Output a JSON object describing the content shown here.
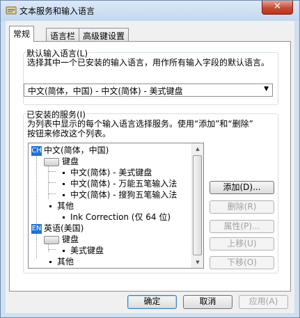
{
  "window": {
    "title": "文本服务和输入语言",
    "close_glyph": "✕"
  },
  "tabs": [
    {
      "label": "常规"
    },
    {
      "label": "语言栏"
    },
    {
      "label": "高级键设置"
    }
  ],
  "default_language": {
    "group_title": "默认输入语言(L)",
    "description": "选择其中一个已安装的输入语言，用作所有输入字段的默认语言。",
    "selected": "中文(简体，中国) - 中文(简体) - 美式键盘"
  },
  "installed_services": {
    "group_title": "已安装的服务(I)",
    "description_line1": "为列表中显示的每个输入语言选择服务。使用“添加”和“删除”",
    "description_line2": "按钮来修改这个列表。",
    "tree": {
      "lang_zh_badge": "CH",
      "lang_zh": "中文(简体，中国)",
      "keyboard_zh": "键盘",
      "kb_items_zh": [
        "中文(简体) - 美式键盘",
        "中文(简体) - 万能五笔输入法",
        "中文(简体) - 搜狗五笔输入法"
      ],
      "other_zh": "其他",
      "ink": "Ink Correction (仅 64 位)",
      "lang_en_badge": "EN",
      "lang_en": "英语(美国)",
      "keyboard_en": "键盘",
      "kb_item_en": "美式键盘",
      "other_en": "其他"
    },
    "buttons": {
      "add": "添加(D)...",
      "remove": "删除(R)",
      "properties": "属性(P)...",
      "move_up": "上移(U)",
      "move_down": "下移(O)"
    }
  },
  "footer": {
    "ok": "确定",
    "cancel": "取消",
    "apply": "应用(A)"
  }
}
